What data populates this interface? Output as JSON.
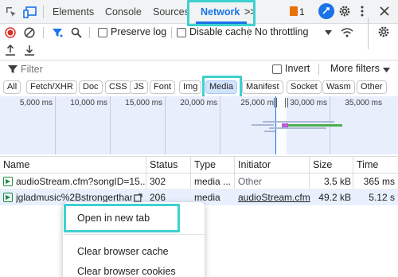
{
  "tabs": [
    {
      "label": "Elements"
    },
    {
      "label": "Console"
    },
    {
      "label": "Sources"
    },
    {
      "label": "Network"
    }
  ],
  "tabs_overflow_icon": ">>",
  "issues_badge": "1",
  "toolbar": {
    "preserve_log": "Preserve log",
    "disable_cache": "Disable cache",
    "throttling": "No throttling"
  },
  "filter": {
    "placeholder": "Filter",
    "invert": "Invert",
    "more_filters": "More filters"
  },
  "type_chips": [
    "All",
    "Fetch/XHR",
    "Doc",
    "CSS",
    "JS",
    "Font",
    "Img",
    "Media",
    "Manifest",
    "Socket",
    "Wasm",
    "Other"
  ],
  "active_chip": "Media",
  "overview_ticks": [
    "5,000 ms",
    "10,000 ms",
    "15,000 ms",
    "20,000 ms",
    "25,000 m",
    "30,000 ms",
    "35,000 ms"
  ],
  "table": {
    "columns": [
      "Name",
      "Status",
      "Type",
      "Initiator",
      "Size",
      "Time"
    ],
    "rows": [
      {
        "name": "audioStream.cfm?songID=15...",
        "status": "302",
        "type": "media ...",
        "initiator": "Other",
        "size": "3.5 kB",
        "time": "365 ms"
      },
      {
        "name": "jgladmusic%2Bstrongerthan",
        "status": "206",
        "type": "media",
        "initiator": "audioStream.cfm",
        "size": "49.2 kB",
        "time": "5.12 s"
      }
    ]
  },
  "context_menu": {
    "open_new_tab": "Open in new tab",
    "clear_cache": "Clear browser cache",
    "clear_cookies": "Clear browser cookies"
  },
  "colors": {
    "accent": "#1a73e8",
    "highlight": "#3fd0d0",
    "record": "#d93025",
    "selected_row": "#e8f0fe"
  }
}
